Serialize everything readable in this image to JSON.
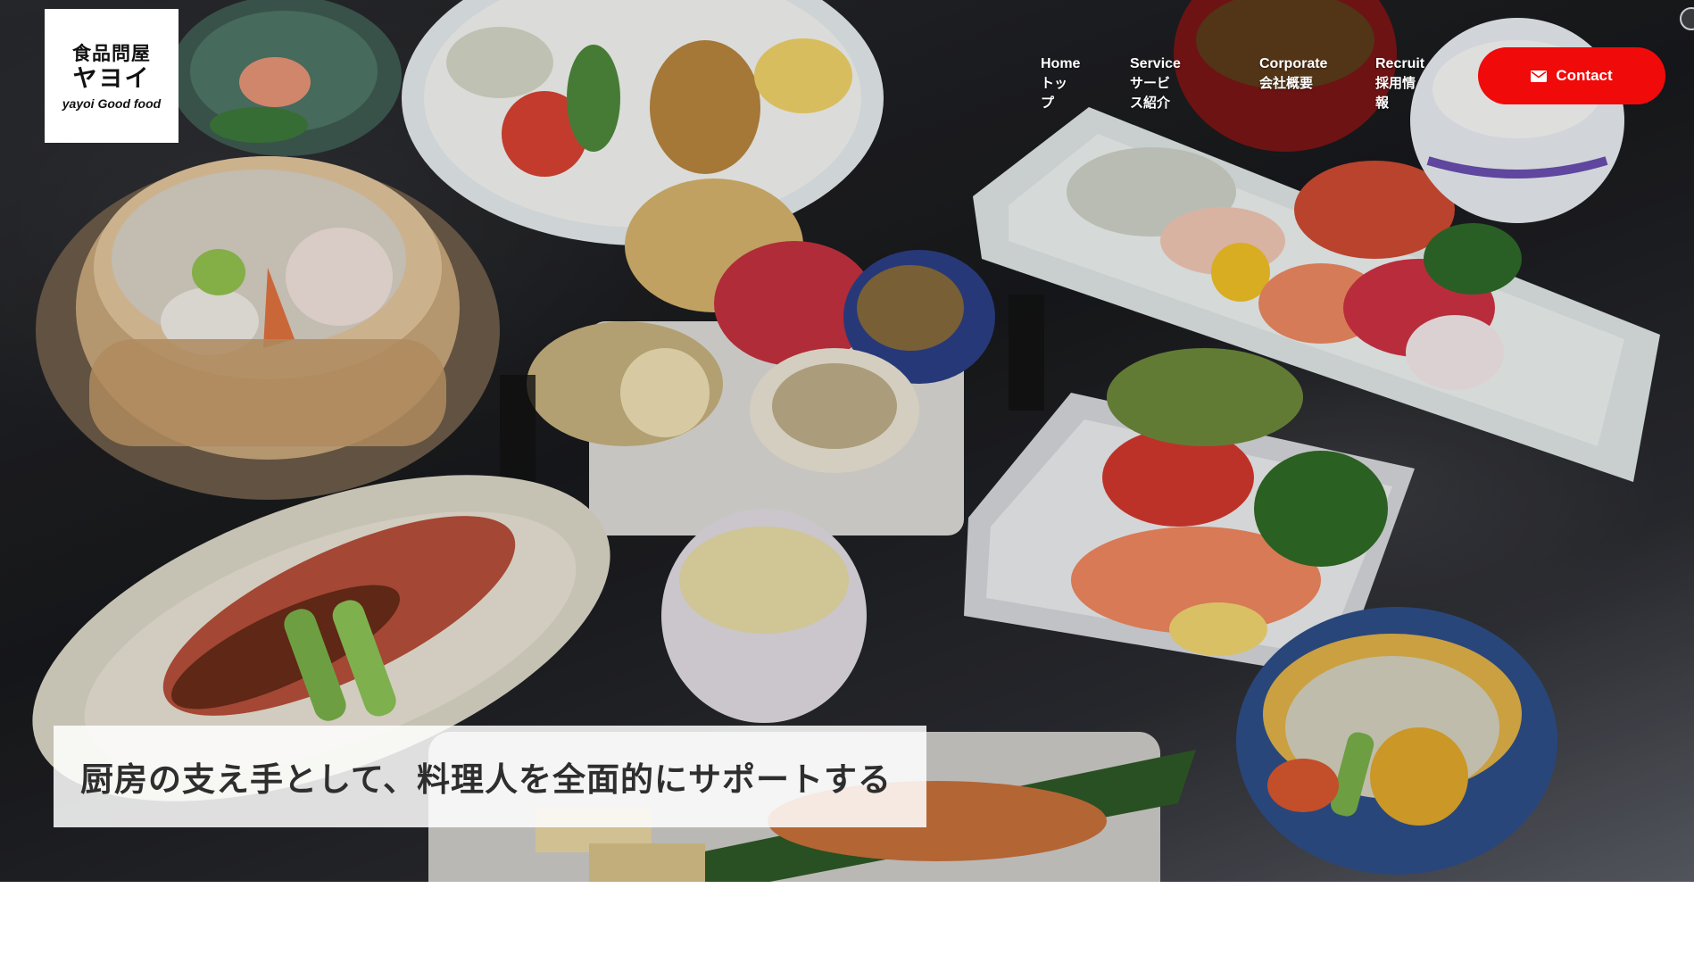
{
  "logo": {
    "line1": "食品問屋",
    "line2": "ヤヨイ",
    "line3": "yayoi Good food"
  },
  "nav": {
    "items": [
      {
        "en": "Home",
        "ja": "トップ"
      },
      {
        "en": "Service",
        "ja": "サービス紹介"
      },
      {
        "en": "Corporate",
        "ja": "会社概要"
      },
      {
        "en": "Recruit",
        "ja": "採用情報"
      }
    ],
    "contact_label": "Contact",
    "contact_icon": "envelope-icon"
  },
  "hero": {
    "tagline": "厨房の支え手として、料理人を全面的にサポートする",
    "image": "japanese-set-meal-photo"
  },
  "colors": {
    "accent": "#f00a0a",
    "hero_dark": "#18191c",
    "tagline_bg": "#ffffff"
  }
}
